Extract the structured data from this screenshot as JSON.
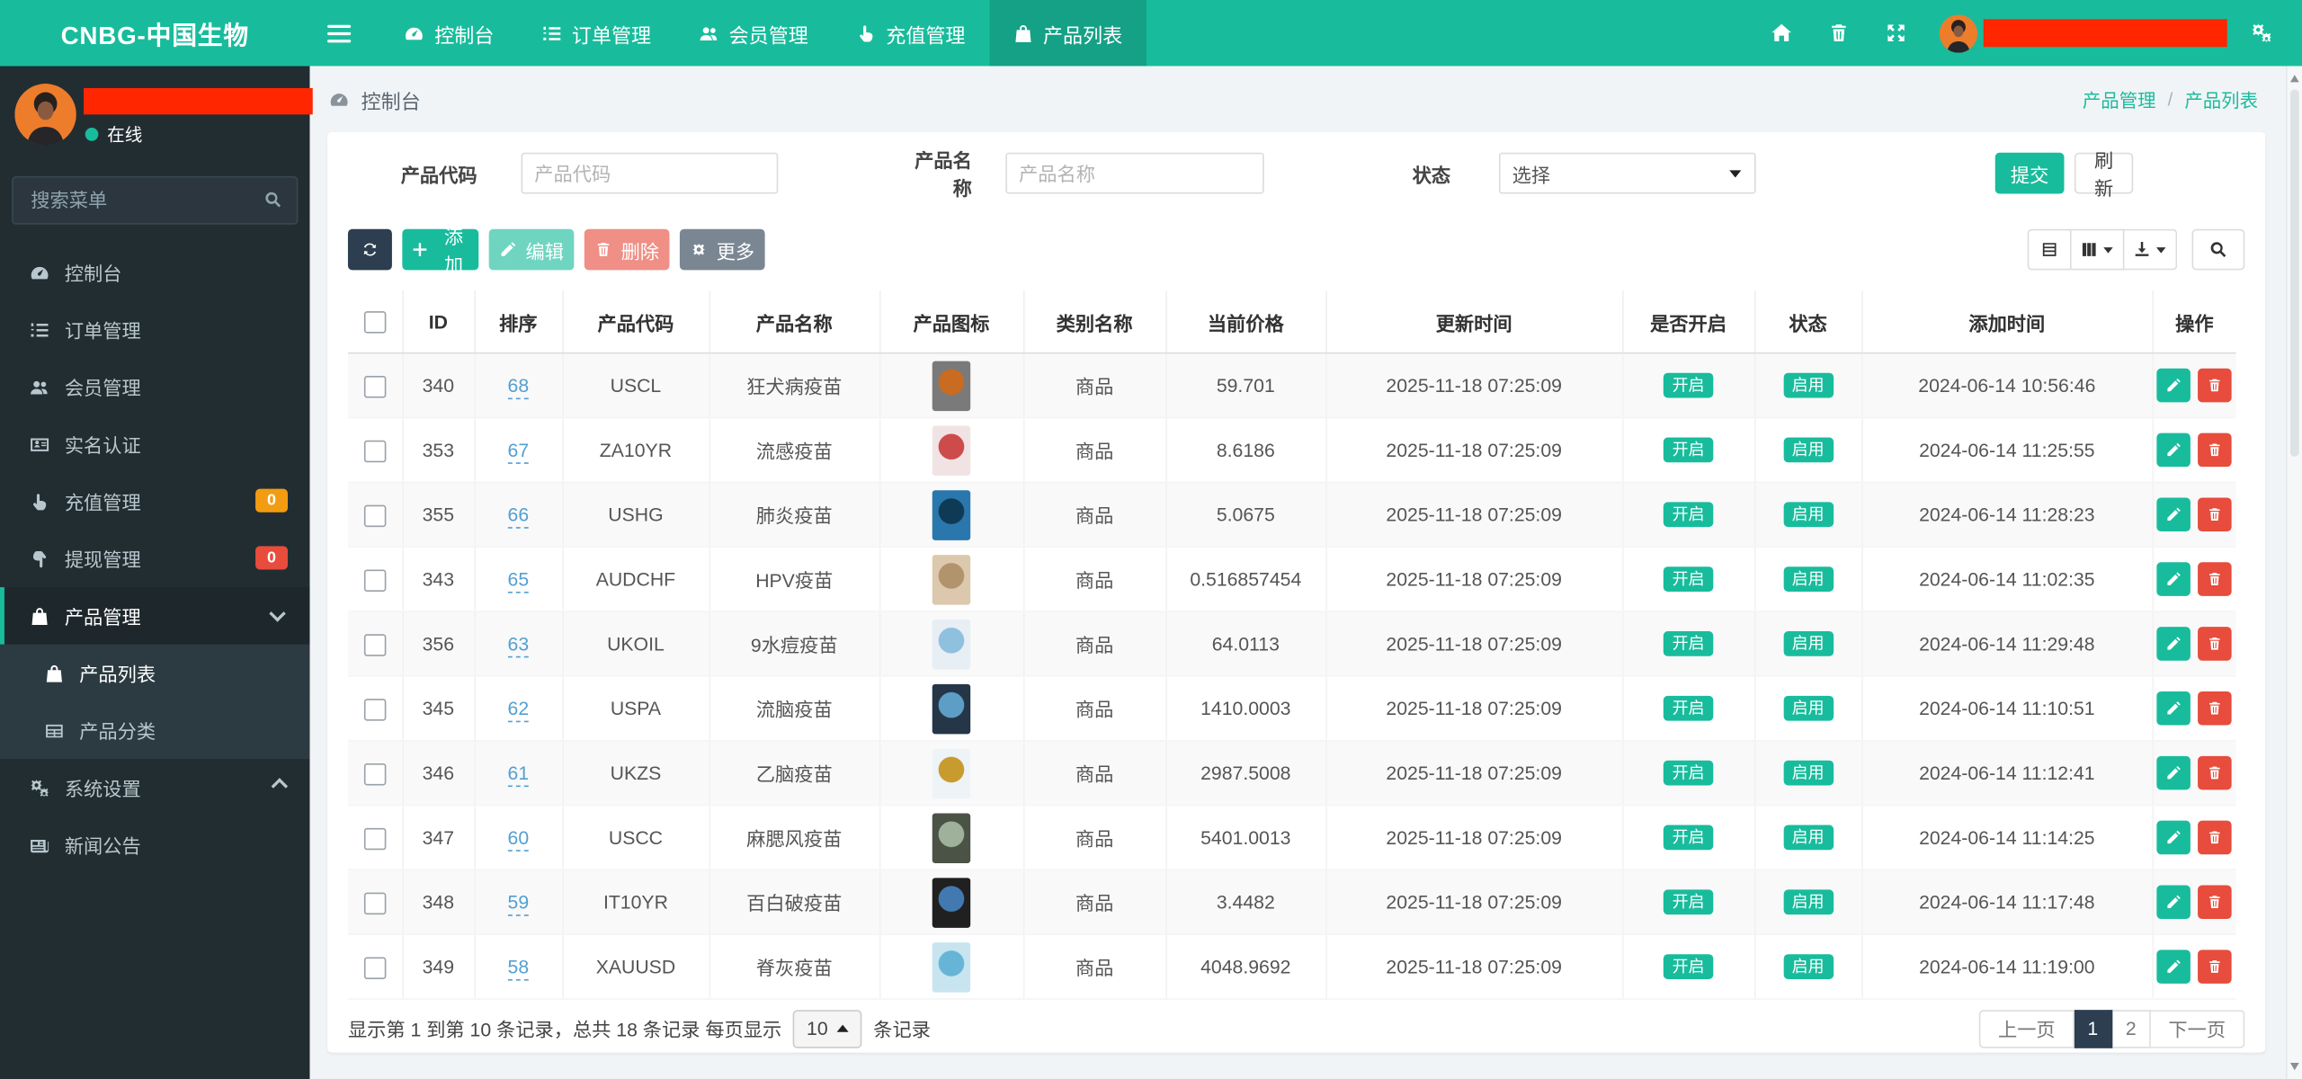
{
  "colors": {
    "topbar": "#18bc9c",
    "accent": "#18bc9c",
    "dark": "#2c3e50",
    "danger": "#e74c3c",
    "warning": "#f39c12",
    "link_blue": "#539fd2",
    "sidebar_bg": "#222d32",
    "sidebar_sub_bg": "#2c3b41",
    "sidebar_active_bg": "#1e282c",
    "sidebar_text": "#b8c7ce",
    "content_bg": "#f1f4f6",
    "redaction": "#ff2600"
  },
  "brand": {
    "logo": "CNBG-中国生物"
  },
  "topnav": {
    "items": [
      {
        "label": "控制台",
        "icon": "gauge",
        "active": false
      },
      {
        "label": "订单管理",
        "icon": "list",
        "active": false
      },
      {
        "label": "会员管理",
        "icon": "users",
        "active": false
      },
      {
        "label": "充值管理",
        "icon": "hand-up",
        "active": false
      },
      {
        "label": "产品列表",
        "icon": "bag",
        "active": true
      }
    ]
  },
  "sidebar": {
    "status_label": "在线",
    "search_placeholder": "搜索菜单",
    "items": [
      {
        "label": "控制台",
        "icon": "gauge"
      },
      {
        "label": "订单管理",
        "icon": "list"
      },
      {
        "label": "会员管理",
        "icon": "users"
      },
      {
        "label": "实名认证",
        "icon": "card"
      },
      {
        "label": "充值管理",
        "icon": "hand-up",
        "badge": "0",
        "badge_color": "#f39c12"
      },
      {
        "label": "提现管理",
        "icon": "hand-down",
        "badge": "0",
        "badge_color": "#e74c3c"
      },
      {
        "label": "产品管理",
        "icon": "bag",
        "active_parent": true,
        "chevron": "down"
      },
      {
        "label": "产品列表",
        "icon": "bag",
        "submenu": true,
        "active": true
      },
      {
        "label": "产品分类",
        "icon": "grid",
        "submenu": true
      },
      {
        "label": "系统设置",
        "icon": "gears",
        "chevron": "left"
      },
      {
        "label": "新闻公告",
        "icon": "news"
      }
    ]
  },
  "breadcrumb": {
    "left": "控制台",
    "parent": "产品管理",
    "separator": "/",
    "current": "产品列表"
  },
  "filters": {
    "code_label": "产品代码",
    "code_placeholder": "产品代码",
    "name_label": "产品名称",
    "name_placeholder": "产品名称",
    "status_label": "状态",
    "status_value": "选择",
    "submit_label": "提交",
    "refresh_label": "刷新"
  },
  "toolbar": {
    "add_label": "添加",
    "edit_label": "编辑",
    "delete_label": "删除",
    "more_label": "更多"
  },
  "table": {
    "columns": [
      "ID",
      "排序",
      "产品代码",
      "产品名称",
      "产品图标",
      "类别名称",
      "当前价格",
      "更新时间",
      "是否开启",
      "状态",
      "添加时间",
      "操作"
    ],
    "rows": [
      {
        "id": "340",
        "sort": "68",
        "code": "USCL",
        "name": "狂犬病疫苗",
        "category": "商品",
        "price": "59.701",
        "updated": "2025-11-18 07:25:09",
        "open": "开启",
        "status": "启用",
        "added": "2024-06-14 10:56:46",
        "icon": [
          "#7a7a7a",
          "#c96b20"
        ]
      },
      {
        "id": "353",
        "sort": "67",
        "code": "ZA10YR",
        "name": "流感疫苗",
        "category": "商品",
        "price": "8.6186",
        "updated": "2025-11-18 07:25:09",
        "open": "开启",
        "status": "启用",
        "added": "2024-06-14 11:25:55",
        "icon": [
          "#f1e3e3",
          "#cd4b4b"
        ]
      },
      {
        "id": "355",
        "sort": "66",
        "code": "USHG",
        "name": "肺炎疫苗",
        "category": "商品",
        "price": "5.0675",
        "updated": "2025-11-18 07:25:09",
        "open": "开启",
        "status": "启用",
        "added": "2024-06-14 11:28:23",
        "icon": [
          "#2a77ad",
          "#0f3a55"
        ]
      },
      {
        "id": "343",
        "sort": "65",
        "code": "AUDCHF",
        "name": "HPV疫苗",
        "category": "商品",
        "price": "0.516857454",
        "updated": "2025-11-18 07:25:09",
        "open": "开启",
        "status": "启用",
        "added": "2024-06-14 11:02:35",
        "icon": [
          "#dcc9ad",
          "#b1946c"
        ]
      },
      {
        "id": "356",
        "sort": "63",
        "code": "UKOIL",
        "name": "9水痘疫苗",
        "category": "商品",
        "price": "64.0113",
        "updated": "2025-11-18 07:25:09",
        "open": "开启",
        "status": "启用",
        "added": "2024-06-14 11:29:48",
        "icon": [
          "#e7eef4",
          "#8fc0de"
        ]
      },
      {
        "id": "345",
        "sort": "62",
        "code": "USPA",
        "name": "流脑疫苗",
        "category": "商品",
        "price": "1410.0003",
        "updated": "2025-11-18 07:25:09",
        "open": "开启",
        "status": "启用",
        "added": "2024-06-14 11:10:51",
        "icon": [
          "#253648",
          "#5d9ec7"
        ]
      },
      {
        "id": "346",
        "sort": "61",
        "code": "UKZS",
        "name": "乙脑疫苗",
        "category": "商品",
        "price": "2987.5008",
        "updated": "2025-11-18 07:25:09",
        "open": "开启",
        "status": "启用",
        "added": "2024-06-14 11:12:41",
        "icon": [
          "#eef3f7",
          "#c79b2d"
        ]
      },
      {
        "id": "347",
        "sort": "60",
        "code": "USCC",
        "name": "麻腮风疫苗",
        "category": "商品",
        "price": "5401.0013",
        "updated": "2025-11-18 07:25:09",
        "open": "开启",
        "status": "启用",
        "added": "2024-06-14 11:14:25",
        "icon": [
          "#4a5345",
          "#9fb09b"
        ]
      },
      {
        "id": "348",
        "sort": "59",
        "code": "IT10YR",
        "name": "百白破疫苗",
        "category": "商品",
        "price": "3.4482",
        "updated": "2025-11-18 07:25:09",
        "open": "开启",
        "status": "启用",
        "added": "2024-06-14 11:17:48",
        "icon": [
          "#202020",
          "#4279b0"
        ]
      },
      {
        "id": "349",
        "sort": "58",
        "code": "XAUUSD",
        "name": "脊灰疫苗",
        "category": "商品",
        "price": "4048.9692",
        "updated": "2025-11-18 07:25:09",
        "open": "开启",
        "status": "启用",
        "added": "2024-06-14 11:19:00",
        "icon": [
          "#c8e5ef",
          "#66b5d6"
        ]
      }
    ]
  },
  "footer": {
    "summary_prefix": "显示第 1 到第 10 条记录，总共 18 条记录 每页显示",
    "page_size": "10",
    "summary_suffix": "条记录",
    "pages": [
      "上一页",
      "1",
      "2",
      "下一页"
    ],
    "active_page": "1"
  }
}
